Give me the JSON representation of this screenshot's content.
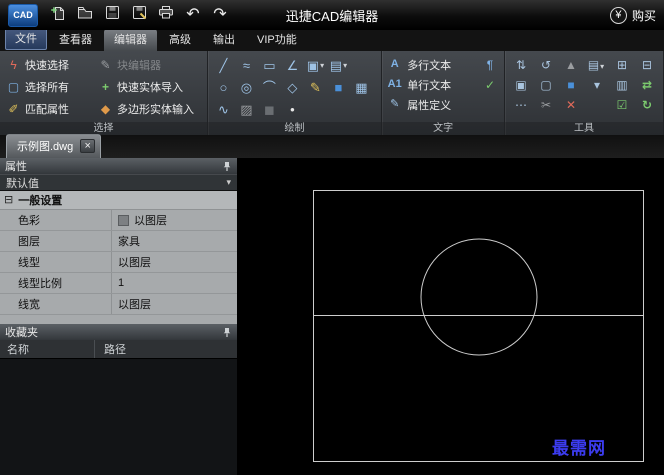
{
  "titlebar": {
    "logo_text": "CAD",
    "app_title": "迅捷CAD编辑器",
    "yen": "¥",
    "buy_label": "购买"
  },
  "menu_tabs": [
    "文件",
    "查看器",
    "编辑器",
    "高级",
    "输出",
    "VIP功能"
  ],
  "ribbon": {
    "group_labels": {
      "selection": "选择",
      "draw": "绘制",
      "text": "文字",
      "tools": "工具"
    },
    "selection_buttons": [
      "快速选择",
      "选择所有",
      "匹配属性",
      "块编辑器",
      "快速实体导入",
      "多边形实体输入"
    ],
    "text_buttons": [
      "多行文本",
      "单行文本",
      "属性定义"
    ]
  },
  "document_tab": {
    "name": "示例图.dwg"
  },
  "properties": {
    "title": "属性",
    "preset": "默认值",
    "section": "一般设置",
    "rows": [
      {
        "label": "色彩",
        "value": "以图层"
      },
      {
        "label": "图层",
        "value": "家具"
      },
      {
        "label": "线型",
        "value": "以图层"
      },
      {
        "label": "线型比例",
        "value": "1"
      },
      {
        "label": "线宽",
        "value": "以图层"
      }
    ]
  },
  "favorites": {
    "title": "收藏夹",
    "columns": [
      "名称",
      "路径"
    ]
  },
  "canvas": {
    "watermark": "最需网"
  },
  "colors": {
    "accent_blue": "#4b8fe0",
    "watermark_blue": "#3c3cf0",
    "canvas_line": "#cdcdcd"
  },
  "glyphs": {
    "caret_down": "▾",
    "collapse_box": "⊟",
    "undo": "↶",
    "redo": "↷",
    "close": "×",
    "quick_select": "ϟ",
    "select_all": "▢",
    "match_props": "✐",
    "block_editor": "✎",
    "entity_import": "+",
    "polygon_input": "◆",
    "line": "╱",
    "revcloud": "≈",
    "rectangle": "▭",
    "polyline": "∠",
    "copy": "▣",
    "block": "▤",
    "circle": "○",
    "ellipse": "◎",
    "arc": "⌒",
    "rot_rect": "◇",
    "pencil": "✎",
    "fill": "■",
    "table": "▦",
    "spline": "∿",
    "hatch": "▨",
    "solid": "◼",
    "point": "•",
    "mtext": "A",
    "stext": "A1",
    "attr_def": "✎",
    "para": "¶",
    "check": "✓",
    "measure": "⇅",
    "rotate": "↺",
    "snap": "▲",
    "layers": "▤",
    "plus_box": "⊞",
    "minus_box": "⊟",
    "explode": "▣",
    "clip": "▢",
    "solid_box": "■",
    "panel": "▥",
    "swap": "⇄",
    "dots": "⋯",
    "cut": "✂",
    "del": "✕",
    "checklist": "☑",
    "refresh": "↻"
  }
}
